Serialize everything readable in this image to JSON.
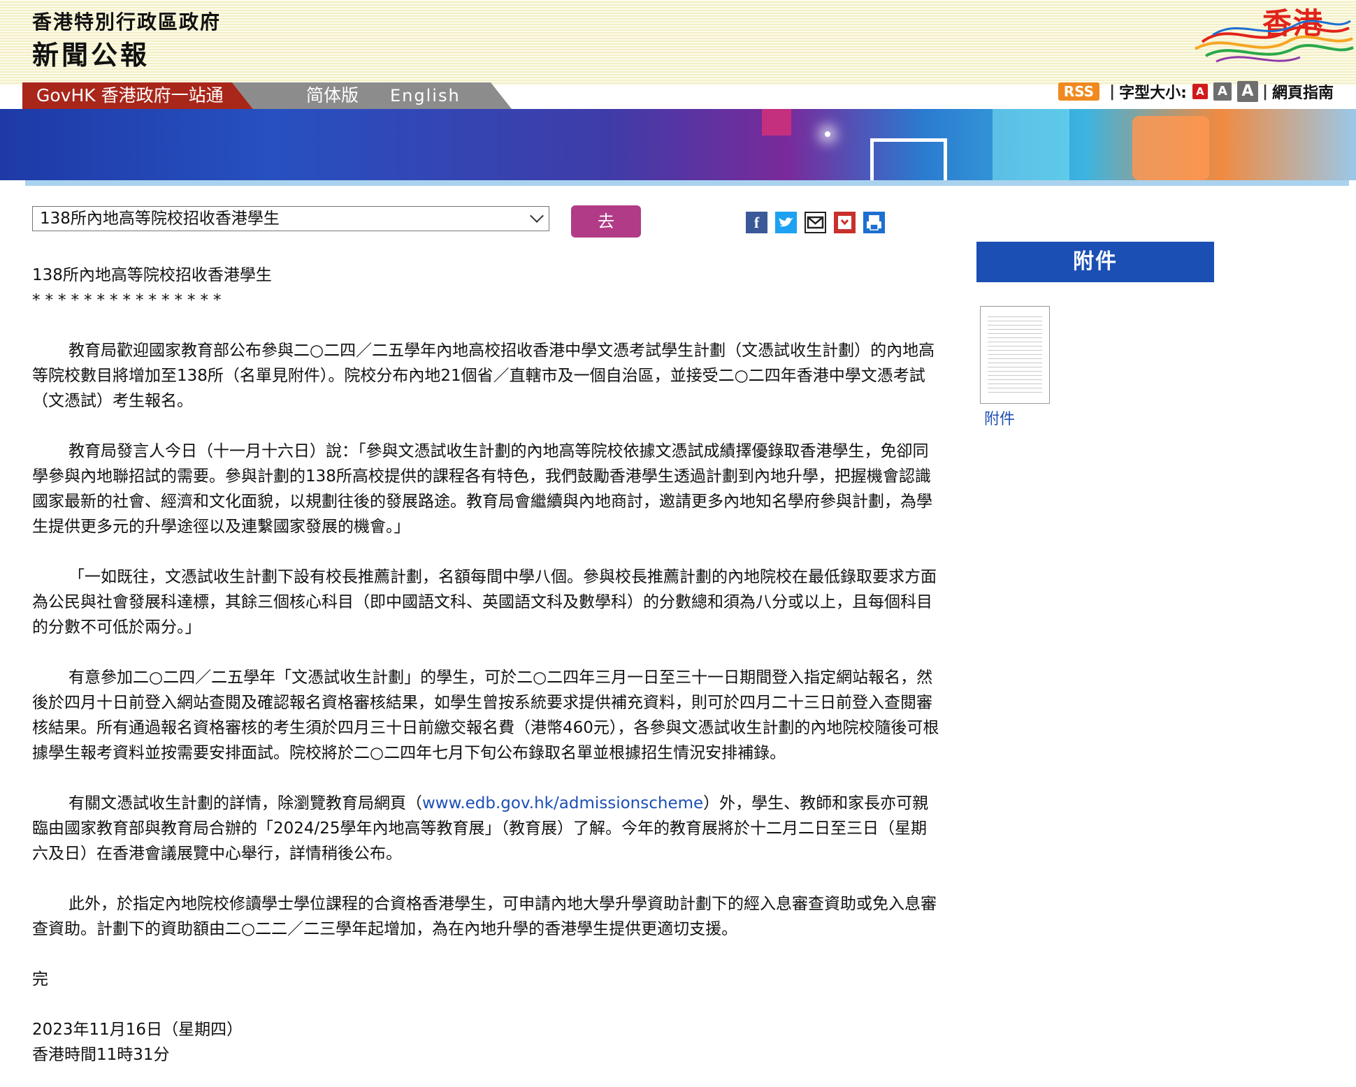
{
  "header": {
    "gov_name": "香港特別行政區政府",
    "press_title": "新聞公報",
    "brand": "香港"
  },
  "nav": {
    "govhk": "GovHK 香港政府一站通",
    "simplified": "简体版",
    "english": "English"
  },
  "tools": {
    "rss": "RSS",
    "font_size_label": "字型大小:",
    "font_a": "A",
    "guide": "網頁指南"
  },
  "controls": {
    "select_value": "138所內地高等院校招收香港學生",
    "go_label": "去"
  },
  "share": {
    "facebook": "f"
  },
  "attachment": {
    "heading": "附件",
    "link_label": "附件"
  },
  "article": {
    "title": "138所內地高等院校招收香港學生",
    "stars": "***************",
    "p1": "教育局歡迎國家教育部公布參與二○二四／二五學年內地高校招收香港中學文憑考試學生計劃（文憑試收生計劃）的內地高等院校數目將增加至138所（名單見附件）。院校分布內地21個省／直轄市及一個自治區，並接受二○二四年香港中學文憑考試（文憑試）考生報名。",
    "p2": "教育局發言人今日（十一月十六日）說：「參與文憑試收生計劃的內地高等院校依據文憑試成績擇優錄取香港學生，免卻同學參與內地聯招試的需要。參與計劃的138所高校提供的課程各有特色，我們鼓勵香港學生透過計劃到內地升學，把握機會認識國家最新的社會、經濟和文化面貌，以規劃往後的發展路途。教育局會繼續與內地商討，邀請更多內地知名學府參與計劃，為學生提供更多元的升學途徑以及連繫國家發展的機會。」",
    "p3": "「一如既往，文憑試收生計劃下設有校長推薦計劃，名額每間中學八個。參與校長推薦計劃的內地院校在最低錄取要求方面為公民與社會發展科達標，其餘三個核心科目（即中國語文科、英國語文科及數學科）的分數總和須為八分或以上，且每個科目的分數不可低於兩分。」",
    "p4": "有意參加二○二四／二五學年「文憑試收生計劃」的學生，可於二○二四年三月一日至三十一日期間登入指定網站報名，然後於四月十日前登入網站查閱及確認報名資格審核結果，如學生曾按系統要求提供補充資料，則可於四月二十三日前登入查閱審核結果。所有通過報名資格審核的考生須於四月三十日前繳交報名費（港幣460元），各參與文憑試收生計劃的內地院校隨後可根據學生報考資料並按需要安排面試。院校將於二○二四年七月下旬公布錄取名單並根據招生情況安排補錄。",
    "p5_before": "有關文憑試收生計劃的詳情，除瀏覽教育局網頁（",
    "p5_link": "www.edb.gov.hk/admissionscheme",
    "p5_after": "）外，學生、教師和家長亦可親臨由國家教育部與教育局合辦的「2024/25學年內地高等教育展」（教育展）了解。今年的教育展將於十二月二日至三日（星期六及日）在香港會議展覽中心舉行，詳情稍後公布。",
    "p6": "此外，於指定內地院校修讀學士學位課程的合資格香港學生，可申請內地大學升學資助計劃下的經入息審查資助或免入息審查資助。計劃下的資助額由二○二二／二三學年起增加，為在內地升學的香港學生提供更適切支援。",
    "end": "完",
    "date": "2023年11月16日（星期四）",
    "time": "香港時間11時31分"
  },
  "colors": {
    "govhk_red": "#a8261a",
    "go_button": "#b13b86",
    "attachment_blue": "#1c4fb4"
  }
}
